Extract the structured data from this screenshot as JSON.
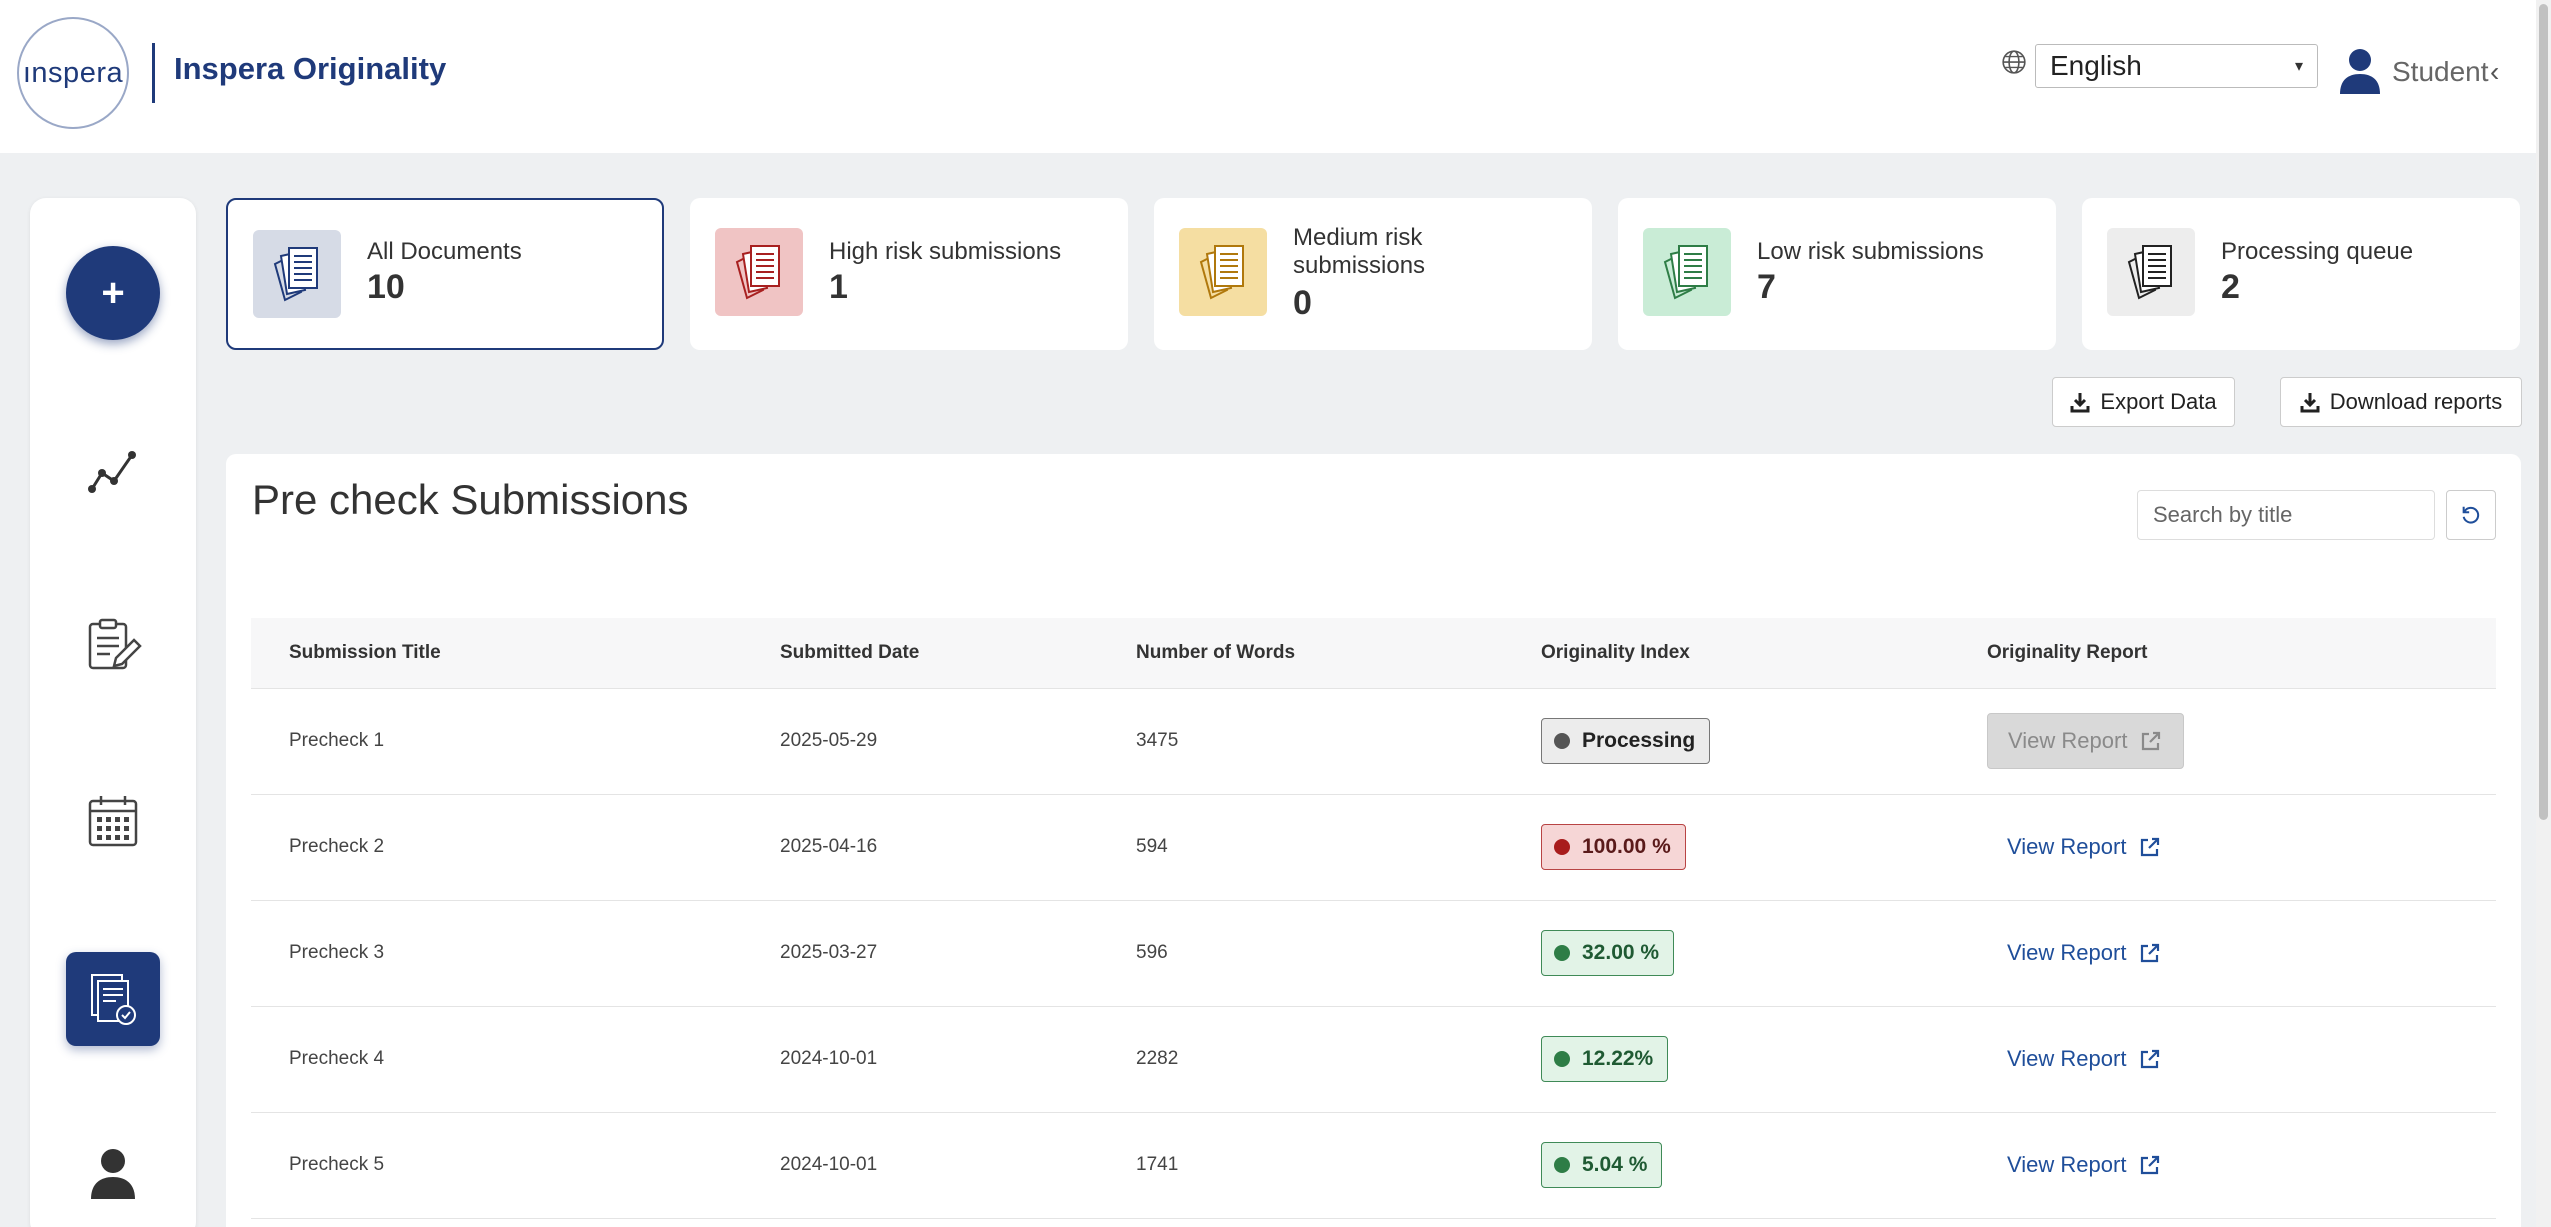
{
  "header": {
    "logo_text": "ınspera",
    "brand_title": "Inspera Originality",
    "language": "English",
    "user_label": "Student",
    "user_chevron": "‹"
  },
  "sidebar": {
    "add_symbol": "+",
    "items": [
      "analytics-icon",
      "assignment-edit-icon",
      "calendar-icon",
      "precheck-icon",
      "profile-icon"
    ],
    "active": "precheck-icon"
  },
  "cards": [
    {
      "label": "All Documents",
      "count": "10",
      "icon_bg": "#d6dbe6",
      "icon_color": "#1f3a7a"
    },
    {
      "label": "High risk submissions",
      "count": "1",
      "icon_bg": "#f0c4c4",
      "icon_color": "#a82020"
    },
    {
      "label": "Medium risk submissions",
      "count": "0",
      "icon_bg": "#f5dea2",
      "icon_color": "#b0780c"
    },
    {
      "label": "Low risk submissions",
      "count": "7",
      "icon_bg": "#c9ecd6",
      "icon_color": "#2e7d46"
    },
    {
      "label": "Processing queue",
      "count": "2",
      "icon_bg": "#ededed",
      "icon_color": "#222222"
    }
  ],
  "actions": {
    "export_label": "Export Data",
    "download_label": "Download reports"
  },
  "panel": {
    "title": "Pre check Submissions",
    "search_placeholder": "Search by title"
  },
  "table": {
    "headers": [
      "Submission Title",
      "Submitted Date",
      "Number of Words",
      "Originality Index",
      "Originality Report"
    ],
    "rows": [
      {
        "title": "Precheck 1",
        "date": "2025-05-29",
        "words": "3475",
        "index": "Processing",
        "status": "grey",
        "report": "View Report",
        "report_enabled": false
      },
      {
        "title": "Precheck 2",
        "date": "2025-04-16",
        "words": "594",
        "index": "100.00 %",
        "status": "red",
        "report": "View Report",
        "report_enabled": true
      },
      {
        "title": "Precheck 3",
        "date": "2025-03-27",
        "words": "596",
        "index": "32.00 %",
        "status": "green",
        "report": "View Report",
        "report_enabled": true
      },
      {
        "title": "Precheck 4",
        "date": "2024-10-01",
        "words": "2282",
        "index": "12.22%",
        "status": "green",
        "report": "View Report",
        "report_enabled": true
      },
      {
        "title": "Precheck 5",
        "date": "2024-10-01",
        "words": "1741",
        "index": "5.04 %",
        "status": "green",
        "report": "View Report",
        "report_enabled": true
      }
    ]
  },
  "colors": {
    "brand": "#1f3a7a",
    "link": "#1f4e9a",
    "background": "#eef0f2"
  }
}
